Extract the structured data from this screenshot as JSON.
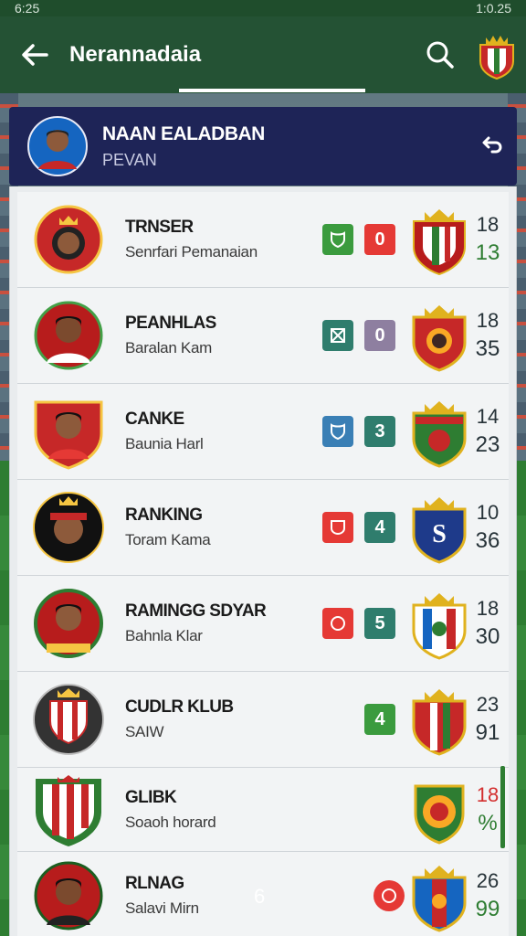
{
  "status_bar": {
    "left": "6:25",
    "right": "1:0.25"
  },
  "app_bar": {
    "title": "Nerannadaia"
  },
  "profile": {
    "name": "NAAN EALADBAN",
    "subtitle": "PEVAN"
  },
  "rows": [
    {
      "name": "TRNSER",
      "sub": "Senrfari Pemanaian",
      "badges": [
        {
          "label": "",
          "color": "#3b9b3e",
          "icon": "shield-icon"
        },
        {
          "label": "0",
          "color": "#e53935"
        }
      ],
      "score_top": "18",
      "score_bottom": "13",
      "bottom_color": "green",
      "top_color": "dark"
    },
    {
      "name": "PEANHLAS",
      "sub": "Baralan Kam",
      "badges": [
        {
          "label": "",
          "color": "#2f7d6d",
          "icon": "cross-icon"
        },
        {
          "label": "0",
          "color": "#8e7fa0"
        }
      ],
      "score_top": "18",
      "score_bottom": "35",
      "bottom_color": "dark",
      "top_color": "dark"
    },
    {
      "name": "CANKE",
      "sub": "Baunia Harl",
      "badges": [
        {
          "label": "",
          "color": "#3a7fb5",
          "icon": "shield-icon"
        },
        {
          "label": "3",
          "color": "#2f7d6d"
        }
      ],
      "score_top": "14",
      "score_bottom": "23",
      "bottom_color": "dark",
      "top_color": "dark"
    },
    {
      "name": "RANKING",
      "sub": "Toram Kama",
      "badges": [
        {
          "label": "",
          "color": "#e53935",
          "icon": "cup-icon"
        },
        {
          "label": "4",
          "color": "#2f7d6d"
        }
      ],
      "score_top": "10",
      "score_bottom": "36",
      "bottom_color": "dark",
      "top_color": "dark"
    },
    {
      "name": "RAMINGG SDYAR",
      "sub": "Bahnla Klar",
      "badges": [
        {
          "label": "",
          "color": "#e53935",
          "icon": "ball-icon"
        },
        {
          "label": "5",
          "color": "#2f7d6d"
        }
      ],
      "score_top": "18",
      "score_bottom": "30",
      "bottom_color": "dark",
      "top_color": "dark"
    },
    {
      "name": "CUDLR KLUB",
      "sub": "SAIW",
      "badges": [
        {
          "label": "4",
          "color": "#3b9b3e"
        }
      ],
      "score_top": "23",
      "score_bottom": "91",
      "bottom_color": "dark",
      "top_color": "dark"
    },
    {
      "name": "GLIBK",
      "sub": "Soaoh horard",
      "badges": [],
      "score_top": "18",
      "score_bottom": "%",
      "bottom_color": "green",
      "top_color": "red"
    },
    {
      "name": "RLNAG",
      "sub": "Salavi Mirn",
      "badges": [
        {
          "label": "",
          "color": "#e53935",
          "icon": "ball-icon",
          "round": true
        }
      ],
      "score_top": "26",
      "score_bottom": "99",
      "bottom_color": "green",
      "top_color": "dark"
    }
  ],
  "page_number": "6"
}
